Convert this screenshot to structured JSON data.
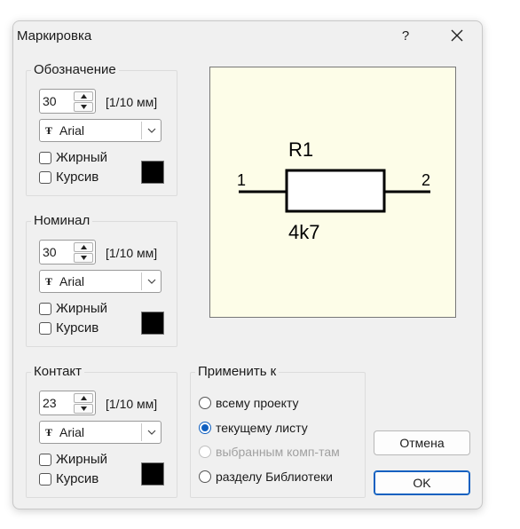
{
  "window": {
    "title": "Маркировка",
    "help_label": "?"
  },
  "groups": [
    {
      "label": "Обозначение",
      "size": "30",
      "units": "[1/10 мм]",
      "font_icon": "Ŧ",
      "font": "Arial",
      "bold_label": "Жирный",
      "italic_label": "Курсив",
      "bold": false,
      "italic": false,
      "color": "#000000"
    },
    {
      "label": "Номинал",
      "size": "30",
      "units": "[1/10 мм]",
      "font_icon": "Ŧ",
      "font": "Arial",
      "bold_label": "Жирный",
      "italic_label": "Курсив",
      "bold": false,
      "italic": false,
      "color": "#000000"
    },
    {
      "label": "Контакт",
      "size": "23",
      "units": "[1/10 мм]",
      "font_icon": "Ŧ",
      "font": "Arial",
      "bold_label": "Жирный",
      "italic_label": "Курсив",
      "bold": false,
      "italic": false,
      "color": "#000000"
    }
  ],
  "preview": {
    "designator": "R1",
    "value": "4k7",
    "pin_left": "1",
    "pin_right": "2",
    "background": "#fdfde8"
  },
  "apply": {
    "label": "Применить к",
    "options": [
      {
        "label": "всему проекту",
        "checked": false,
        "disabled": false
      },
      {
        "label": "текущему листу",
        "checked": true,
        "disabled": false
      },
      {
        "label": "выбранным комп-там",
        "checked": false,
        "disabled": true
      },
      {
        "label": "разделу Библиотеки",
        "checked": false,
        "disabled": false
      }
    ]
  },
  "buttons": {
    "cancel": "Отмена",
    "ok": "OK"
  },
  "colors": {
    "accent": "#1060c0",
    "dialog_bg": "#f0f0f0"
  }
}
